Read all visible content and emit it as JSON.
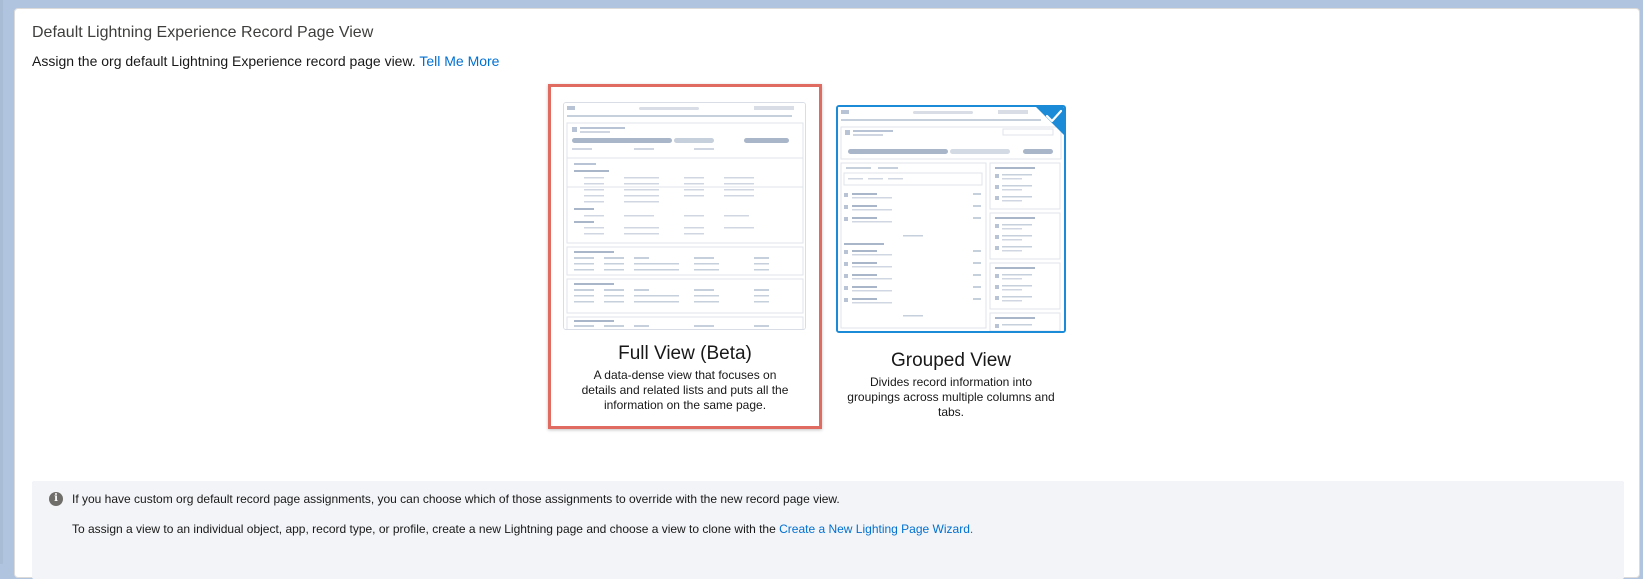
{
  "section": {
    "title": "Default Lightning Experience Record Page View",
    "description": "Assign the org default Lightning Experience record page view.",
    "tell_me_more": "Tell Me More"
  },
  "options": {
    "full": {
      "label": "Full View (Beta)",
      "description": "A data-dense view that focuses on details and related lists and puts all the information on the same page.",
      "selected": false
    },
    "grouped": {
      "label": "Grouped View",
      "description": "Divides record information into groupings across multiple columns and tabs.",
      "selected": true
    }
  },
  "info": {
    "line1": "If you have custom org default record page assignments, you can choose which of those assignments to override with the new record page view.",
    "line2_prefix": "To assign a view to an individual object, app, record type, or profile, create a new Lightning page and choose a view to clone with the ",
    "line2_link": "Create a New Lighting Page Wizard."
  },
  "colors": {
    "link": "#0070d2",
    "selected_border": "#1b8bd8",
    "highlight_border": "#e06b61"
  },
  "icons": {
    "info": "info-icon",
    "check": "check-icon"
  }
}
